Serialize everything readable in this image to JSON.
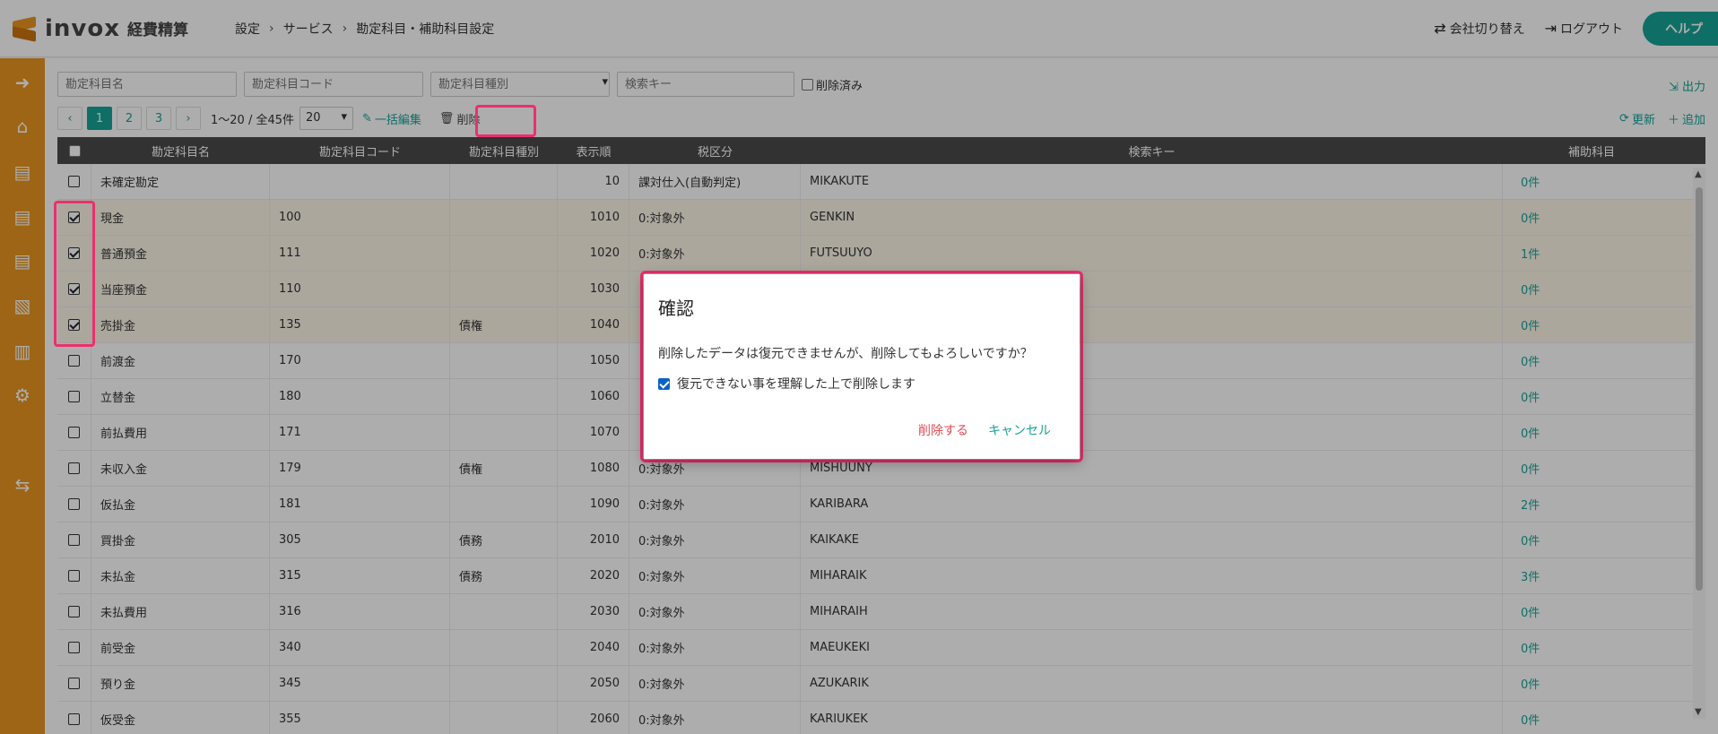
{
  "header": {
    "logo_text": "invox",
    "logo_sub": "経費精算",
    "breadcrumb": [
      "設定",
      "サービス",
      "勘定科目・補助科目設定"
    ],
    "switch_company": "会社切り替え",
    "logout": "ログアウト",
    "help": "ヘルプ"
  },
  "sidebar": {
    "icons": [
      "arrow-right-circle-icon",
      "home-icon",
      "document-icon",
      "document-icon",
      "document-icon",
      "document-export-icon",
      "chart-icon",
      "gear-icon",
      "transfer-icon"
    ]
  },
  "filters": {
    "name_placeholder": "勘定科目名",
    "code_placeholder": "勘定科目コード",
    "type_placeholder": "勘定科目種別",
    "search_placeholder": "検索キー",
    "deleted_label": "削除済み",
    "export": "出力"
  },
  "pager": {
    "pages": [
      "1",
      "2",
      "3"
    ],
    "info": "1〜20 / 全45件",
    "per_page": "20",
    "bulk_edit": "一括編集",
    "delete": "削除",
    "refresh": "更新",
    "add": "追加"
  },
  "table": {
    "columns": [
      "勘定科目名",
      "勘定科目コード",
      "勘定科目種別",
      "表示順",
      "税区分",
      "検索キー",
      "補助科目"
    ],
    "rows": [
      {
        "checked": false,
        "name": "未確定勘定",
        "code": "",
        "type": "",
        "order": "10",
        "tax": "課対仕入(自動判定)",
        "key": "MIKAKUTE",
        "sub": "0件"
      },
      {
        "checked": true,
        "name": "現金",
        "code": "100",
        "type": "",
        "order": "1010",
        "tax": "0:対象外",
        "key": "GENKIN",
        "sub": "0件"
      },
      {
        "checked": true,
        "name": "普通預金",
        "code": "111",
        "type": "",
        "order": "1020",
        "tax": "0:対象外",
        "key": "FUTSUUYO",
        "sub": "1件"
      },
      {
        "checked": true,
        "name": "当座預金",
        "code": "110",
        "type": "",
        "order": "1030",
        "tax": "",
        "key": "",
        "sub": "0件"
      },
      {
        "checked": true,
        "name": "売掛金",
        "code": "135",
        "type": "債権",
        "order": "1040",
        "tax": "",
        "key": "",
        "sub": "0件"
      },
      {
        "checked": false,
        "name": "前渡金",
        "code": "170",
        "type": "",
        "order": "1050",
        "tax": "",
        "key": "",
        "sub": "0件"
      },
      {
        "checked": false,
        "name": "立替金",
        "code": "180",
        "type": "",
        "order": "1060",
        "tax": "",
        "key": "",
        "sub": "0件"
      },
      {
        "checked": false,
        "name": "前払費用",
        "code": "171",
        "type": "",
        "order": "1070",
        "tax": "",
        "key": "",
        "sub": "0件"
      },
      {
        "checked": false,
        "name": "未収入金",
        "code": "179",
        "type": "債権",
        "order": "1080",
        "tax": "0:対象外",
        "key": "MISHUUNY",
        "sub": "0件"
      },
      {
        "checked": false,
        "name": "仮払金",
        "code": "181",
        "type": "",
        "order": "1090",
        "tax": "0:対象外",
        "key": "KARIBARA",
        "sub": "2件"
      },
      {
        "checked": false,
        "name": "買掛金",
        "code": "305",
        "type": "債務",
        "order": "2010",
        "tax": "0:対象外",
        "key": "KAIKAKE",
        "sub": "0件"
      },
      {
        "checked": false,
        "name": "未払金",
        "code": "315",
        "type": "債務",
        "order": "2020",
        "tax": "0:対象外",
        "key": "MIHARAIK",
        "sub": "3件"
      },
      {
        "checked": false,
        "name": "未払費用",
        "code": "316",
        "type": "",
        "order": "2030",
        "tax": "0:対象外",
        "key": "MIHARAIH",
        "sub": "0件"
      },
      {
        "checked": false,
        "name": "前受金",
        "code": "340",
        "type": "",
        "order": "2040",
        "tax": "0:対象外",
        "key": "MAEUKEKI",
        "sub": "0件"
      },
      {
        "checked": false,
        "name": "預り金",
        "code": "345",
        "type": "",
        "order": "2050",
        "tax": "0:対象外",
        "key": "AZUKARIK",
        "sub": "0件"
      },
      {
        "checked": false,
        "name": "仮受金",
        "code": "355",
        "type": "",
        "order": "2060",
        "tax": "0:対象外",
        "key": "KARIUKEK",
        "sub": "0件"
      }
    ]
  },
  "dialog": {
    "title": "確認",
    "message": "削除したデータは復元できませんが、削除してもよろしいですか？",
    "confirm_label": "復元できない事を理解した上で削除します",
    "confirm_checked": true,
    "delete_button": "削除する",
    "cancel_button": "キャンセル"
  },
  "colors": {
    "accent": "#17a497",
    "sidebar": "#e8951f",
    "highlight": "#ec2f6e",
    "danger": "#e24a56"
  }
}
